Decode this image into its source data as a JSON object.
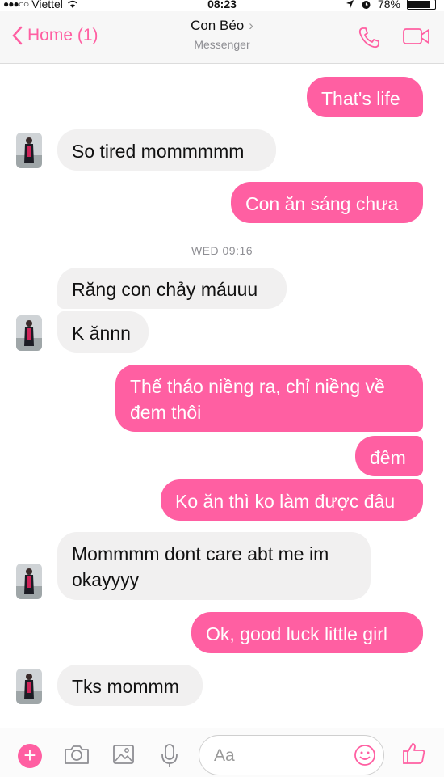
{
  "status_bar": {
    "carrier": "Viettel",
    "time": "08:23",
    "battery": "78%"
  },
  "header": {
    "back_label": "Home (1)",
    "contact_name": "Con Béo",
    "subtitle": "Messenger",
    "icons": [
      "phone-icon",
      "video-icon"
    ]
  },
  "messages": [
    {
      "from": "me",
      "text": "That's life"
    },
    {
      "from": "them",
      "text": "So tired mommmmm"
    },
    {
      "from": "me",
      "text": "Con ăn sáng chưa"
    },
    {
      "timestamp": "WED 09:16"
    },
    {
      "from": "them",
      "text": "Răng con chảy máuuu"
    },
    {
      "from": "them",
      "text": "K ănnn"
    },
    {
      "from": "me",
      "text": "Thế tháo niềng ra, chỉ niềng về đem thôi"
    },
    {
      "from": "me",
      "text": "đêm"
    },
    {
      "from": "me",
      "text": "Ko ăn thì ko làm được đâu"
    },
    {
      "from": "them",
      "text": "Mommmm dont care abt me im okayyyy"
    },
    {
      "from": "me",
      "text": "Ok, good luck little girl"
    },
    {
      "from": "them",
      "text": "Tks mommm"
    }
  ],
  "composer": {
    "placeholder": "Aa",
    "icons": [
      "plus-icon",
      "camera-icon",
      "image-icon",
      "microphone-icon",
      "smiley-icon",
      "thumbs-up-icon"
    ]
  },
  "colors": {
    "accent": "#ff5fa2",
    "incoming_bubble": "#f1f0f0",
    "outgoing_text": "#ffffff"
  }
}
